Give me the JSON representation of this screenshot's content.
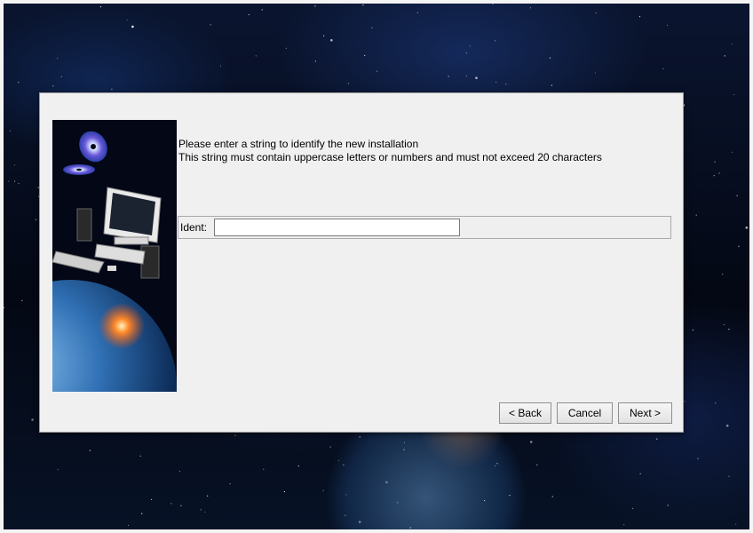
{
  "dialog": {
    "prompt_line1": "Please enter a string to identify the new installation",
    "prompt_line2": "This string must contain uppercase letters or numbers and must not exceed 20 characters",
    "ident_label": "Ident:",
    "ident_value": "",
    "buttons": {
      "back": "< Back",
      "cancel": "Cancel",
      "next": "Next >"
    }
  },
  "icons": {
    "side_image": "computer-with-cds-over-earth-illustration"
  }
}
